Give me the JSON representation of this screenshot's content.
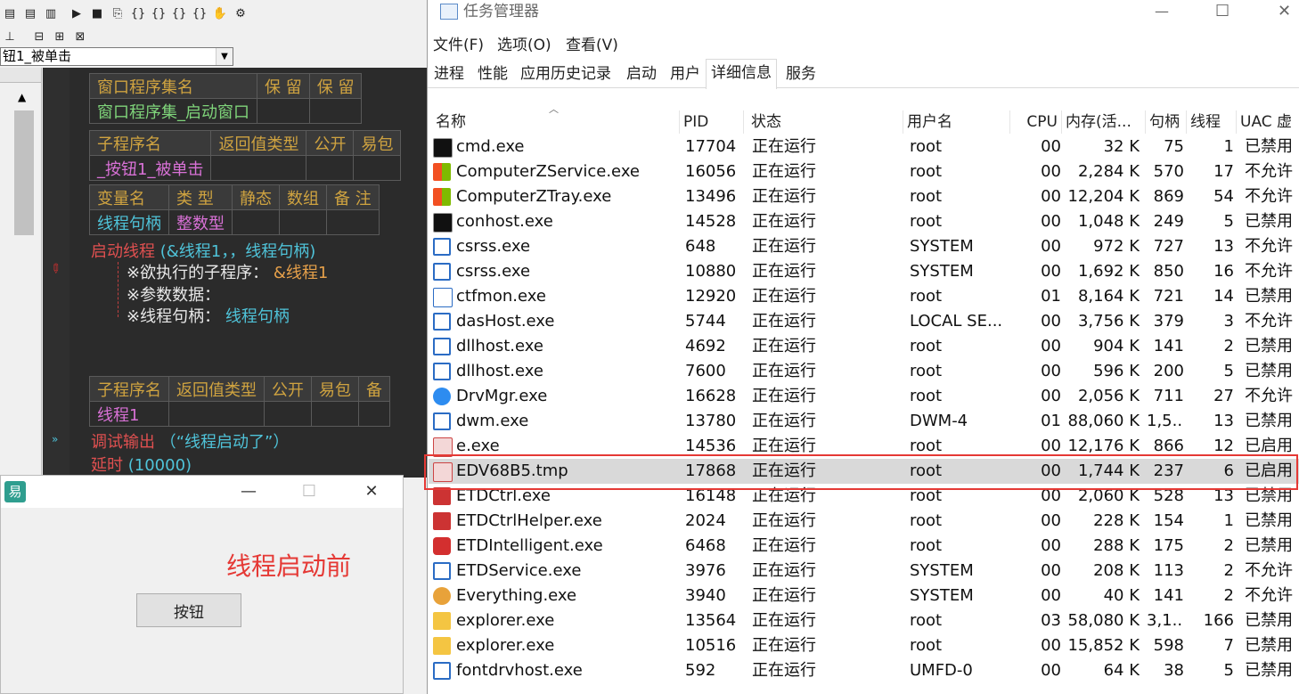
{
  "ide": {
    "combo_value": "钮1_被单击",
    "table1": {
      "headers": [
        "窗口程序集名",
        "保 留",
        "保 留"
      ],
      "value": "窗口程序集_启动窗口"
    },
    "table2": {
      "headers": [
        "子程序名",
        "返回值类型",
        "公开",
        "易包"
      ],
      "value": "_按钮1_被单击"
    },
    "table3": {
      "headers": [
        "变量名",
        "类 型",
        "静态",
        "数组",
        "备 注"
      ],
      "var_name": "线程句柄",
      "var_type": "整数型"
    },
    "call_line": {
      "func": "启动线程",
      "args": "(&线程1，，线程句柄)"
    },
    "params": [
      {
        "label": "※欲执行的子程序：",
        "value": "&线程1"
      },
      {
        "label": "※参数数据：",
        "value": ""
      },
      {
        "label": "※线程句柄：",
        "value": "线程句柄"
      }
    ],
    "table4": {
      "headers": [
        "子程序名",
        "返回值类型",
        "公开",
        "易包",
        "备"
      ],
      "value": "线程1"
    },
    "debug_line": {
      "func": "调试输出",
      "args": "（“线程启动了”）"
    },
    "delay_line": {
      "func": "延时",
      "args": "(10000)"
    }
  },
  "small_window": {
    "label_text": "线程启动前",
    "button_label": "按钮",
    "label_color": "#e53935"
  },
  "task_manager": {
    "title": "任务管理器",
    "menus": [
      "文件(F)",
      "选项(O)",
      "查看(V)"
    ],
    "tabs": [
      "进程",
      "性能",
      "应用历史记录",
      "启动",
      "用户",
      "详细信息",
      "服务"
    ],
    "selected_tab": "详细信息",
    "columns": [
      "名称",
      "PID",
      "状态",
      "用户名",
      "CPU",
      "内存(活...",
      "句柄",
      "线程",
      "UAC 虚"
    ],
    "rows": [
      {
        "name": "cmd.exe",
        "pid": "17704",
        "status": "正在运行",
        "user": "root",
        "cpu": "00",
        "mem": "32 K",
        "handles": "75",
        "threads": "1",
        "uac": "已禁用",
        "icon": "console-icon"
      },
      {
        "name": "ComputerZService.exe",
        "pid": "16056",
        "status": "正在运行",
        "user": "root",
        "cpu": "00",
        "mem": "2,284 K",
        "handles": "570",
        "threads": "17",
        "uac": "不允许",
        "icon": "windows-flag-icon"
      },
      {
        "name": "ComputerZTray.exe",
        "pid": "13496",
        "status": "正在运行",
        "user": "root",
        "cpu": "00",
        "mem": "12,204 K",
        "handles": "869",
        "threads": "54",
        "uac": "不允许",
        "icon": "windows-flag-icon"
      },
      {
        "name": "conhost.exe",
        "pid": "14528",
        "status": "正在运行",
        "user": "root",
        "cpu": "00",
        "mem": "1,048 K",
        "handles": "249",
        "threads": "5",
        "uac": "已禁用",
        "icon": "console-icon"
      },
      {
        "name": "csrss.exe",
        "pid": "648",
        "status": "正在运行",
        "user": "SYSTEM",
        "cpu": "00",
        "mem": "972 K",
        "handles": "727",
        "threads": "13",
        "uac": "不允许",
        "icon": "window-app-icon"
      },
      {
        "name": "csrss.exe",
        "pid": "10880",
        "status": "正在运行",
        "user": "SYSTEM",
        "cpu": "00",
        "mem": "1,692 K",
        "handles": "850",
        "threads": "16",
        "uac": "不允许",
        "icon": "window-app-icon"
      },
      {
        "name": "ctfmon.exe",
        "pid": "12920",
        "status": "正在运行",
        "user": "root",
        "cpu": "01",
        "mem": "8,164 K",
        "handles": "721",
        "threads": "14",
        "uac": "已禁用",
        "icon": "pen-icon"
      },
      {
        "name": "dasHost.exe",
        "pid": "5744",
        "status": "正在运行",
        "user": "LOCAL SE...",
        "cpu": "00",
        "mem": "3,756 K",
        "handles": "379",
        "threads": "3",
        "uac": "不允许",
        "icon": "window-app-icon"
      },
      {
        "name": "dllhost.exe",
        "pid": "4692",
        "status": "正在运行",
        "user": "root",
        "cpu": "00",
        "mem": "904 K",
        "handles": "141",
        "threads": "2",
        "uac": "已禁用",
        "icon": "window-app-icon"
      },
      {
        "name": "dllhost.exe",
        "pid": "7600",
        "status": "正在运行",
        "user": "root",
        "cpu": "00",
        "mem": "596 K",
        "handles": "200",
        "threads": "5",
        "uac": "已禁用",
        "icon": "window-app-icon"
      },
      {
        "name": "DrvMgr.exe",
        "pid": "16628",
        "status": "正在运行",
        "user": "root",
        "cpu": "00",
        "mem": "2,056 K",
        "handles": "711",
        "threads": "27",
        "uac": "不允许",
        "icon": "driver-manager-icon"
      },
      {
        "name": "dwm.exe",
        "pid": "13780",
        "status": "正在运行",
        "user": "DWM-4",
        "cpu": "01",
        "mem": "88,060 K",
        "handles": "1,5...",
        "threads": "13",
        "uac": "已禁用",
        "icon": "window-app-icon"
      },
      {
        "name": "e.exe",
        "pid": "14536",
        "status": "正在运行",
        "user": "root",
        "cpu": "00",
        "mem": "12,176 K",
        "handles": "866",
        "threads": "12",
        "uac": "已启用",
        "icon": "e-language-icon"
      },
      {
        "name": "EDV68B5.tmp",
        "pid": "17868",
        "status": "正在运行",
        "user": "root",
        "cpu": "00",
        "mem": "1,744 K",
        "handles": "237",
        "threads": "6",
        "uac": "已启用",
        "icon": "e-language-icon"
      },
      {
        "name": "ETDCtrl.exe",
        "pid": "16148",
        "status": "正在运行",
        "user": "root",
        "cpu": "00",
        "mem": "2,060 K",
        "handles": "528",
        "threads": "13",
        "uac": "已禁用",
        "icon": "touchpad-icon"
      },
      {
        "name": "ETDCtrlHelper.exe",
        "pid": "2024",
        "status": "正在运行",
        "user": "root",
        "cpu": "00",
        "mem": "228 K",
        "handles": "154",
        "threads": "1",
        "uac": "已禁用",
        "icon": "touchpad-icon"
      },
      {
        "name": "ETDIntelligent.exe",
        "pid": "6468",
        "status": "正在运行",
        "user": "root",
        "cpu": "00",
        "mem": "288 K",
        "handles": "175",
        "threads": "2",
        "uac": "已禁用",
        "icon": "elan-icon"
      },
      {
        "name": "ETDService.exe",
        "pid": "3976",
        "status": "正在运行",
        "user": "SYSTEM",
        "cpu": "00",
        "mem": "208 K",
        "handles": "113",
        "threads": "2",
        "uac": "不允许",
        "icon": "window-app-icon"
      },
      {
        "name": "Everything.exe",
        "pid": "3940",
        "status": "正在运行",
        "user": "SYSTEM",
        "cpu": "00",
        "mem": "40 K",
        "handles": "141",
        "threads": "2",
        "uac": "不允许",
        "icon": "magnifier-icon"
      },
      {
        "name": "explorer.exe",
        "pid": "13564",
        "status": "正在运行",
        "user": "root",
        "cpu": "03",
        "mem": "58,080 K",
        "handles": "3,1...",
        "threads": "166",
        "uac": "已禁用",
        "icon": "folder-icon"
      },
      {
        "name": "explorer.exe",
        "pid": "10516",
        "status": "正在运行",
        "user": "root",
        "cpu": "00",
        "mem": "15,852 K",
        "handles": "598",
        "threads": "7",
        "uac": "已禁用",
        "icon": "folder-icon"
      },
      {
        "name": "fontdrvhost.exe",
        "pid": "592",
        "status": "正在运行",
        "user": "UMFD-0",
        "cpu": "00",
        "mem": "64 K",
        "handles": "38",
        "threads": "5",
        "uac": "已禁用",
        "icon": "window-app-icon"
      }
    ],
    "selected_row": "EDV68B5.tmp",
    "highlight_color": "#e53935"
  }
}
